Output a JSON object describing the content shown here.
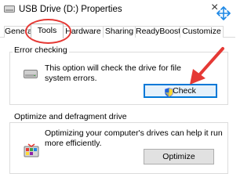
{
  "window": {
    "title": "USB Drive (D:) Properties",
    "icons": {
      "drive": "usb-drive-icon",
      "close": "close-icon",
      "cursor": "move-cursor-icon"
    }
  },
  "tabs": [
    {
      "label": "General",
      "active": false
    },
    {
      "label": "Tools",
      "active": true
    },
    {
      "label": "Hardware",
      "active": false
    },
    {
      "label": "Sharing",
      "active": false
    },
    {
      "label": "ReadyBoost",
      "active": false
    },
    {
      "label": "Customize",
      "active": false
    }
  ],
  "error_checking": {
    "heading": "Error checking",
    "description_line1": "This option will check the drive for file",
    "description_line2": "system errors.",
    "button_label": "Check",
    "icons": {
      "drive": "hard-drive-icon",
      "shield": "uac-shield-icon"
    }
  },
  "optimize": {
    "heading": "Optimize and defragment drive",
    "description_line1": "Optimizing your computer's drives can help it run",
    "description_line2": "more efficiently.",
    "button_label": "Optimize",
    "icons": {
      "defrag": "defragment-icon"
    }
  },
  "annotations": {
    "highlight_color": "#e53935",
    "arrow": "red-arrow-icon",
    "ring": "tools-tab-ring"
  }
}
